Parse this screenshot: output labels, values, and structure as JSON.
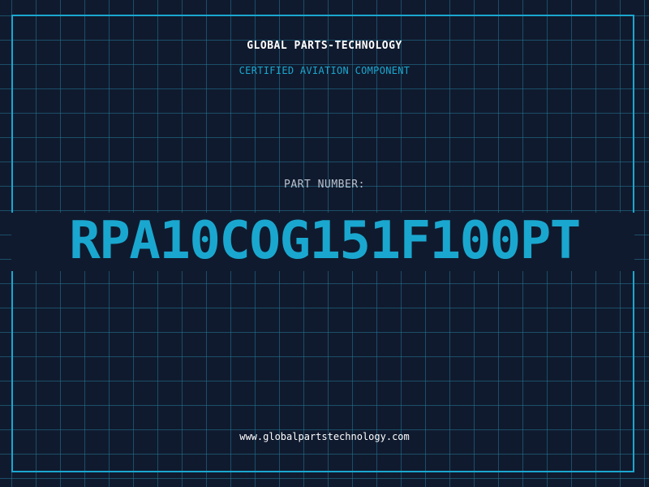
{
  "company_name": "GLOBAL PARTS-TECHNOLOGY",
  "subtitle": "CERTIFIED AVIATION COMPONENT",
  "part_number_label": "PART NUMBER:",
  "part_number": "RPA10COG151F100PT",
  "website": "www.globalpartstechnology.com",
  "colors": {
    "background": "#101a2e",
    "accent": "#1aa7cf",
    "grid": "#22788f",
    "text_primary": "#ffffff",
    "text_muted": "#b9c2cf"
  }
}
